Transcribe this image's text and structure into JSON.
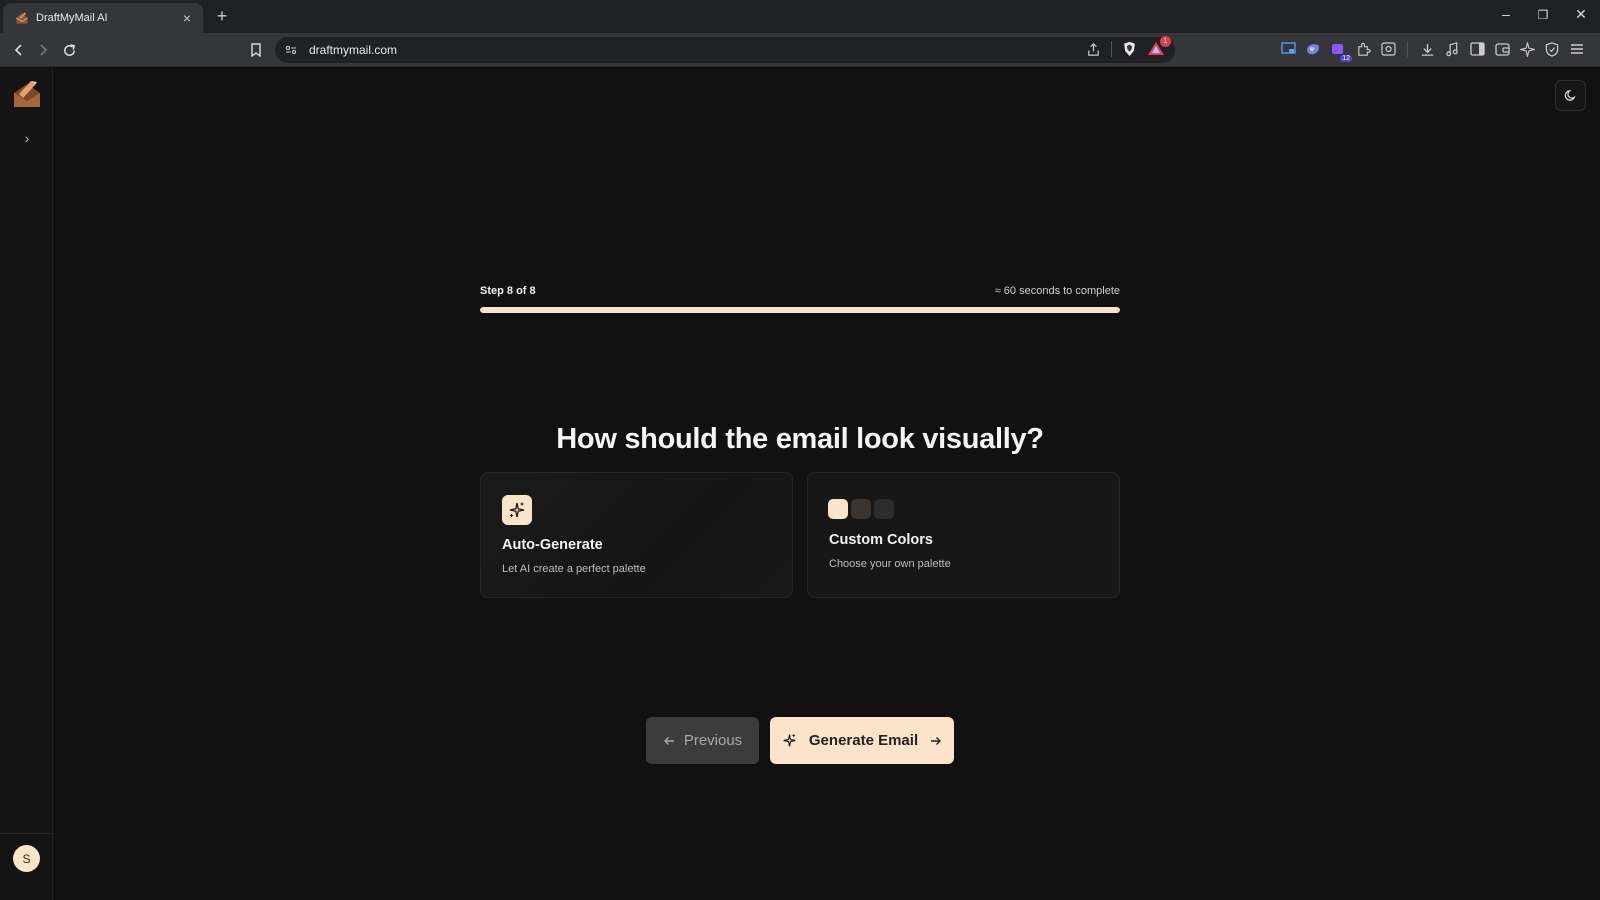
{
  "browser": {
    "tab_title": "DraftMyMail AI",
    "tab_close": "×",
    "new_tab": "+",
    "url": "draftmymail.com",
    "notification_count": "1",
    "extension_badge": "12",
    "window_controls": {
      "minimize": "–",
      "restore": "❐",
      "close": "✕"
    }
  },
  "sidebar": {
    "expand_glyph": "›",
    "avatar_initial": "S"
  },
  "progress": {
    "step_label": "Step 8 of 8",
    "time_label": "≈ 60 seconds to complete",
    "fraction": 1.0
  },
  "question": "How should the email look visually?",
  "options": [
    {
      "title": "Auto-Generate",
      "subtitle": "Let AI create a perfect palette",
      "icon": "sparkles-icon"
    },
    {
      "title": "Custom Colors",
      "subtitle": "Choose your own palette",
      "swatches": [
        "#fbe3cc",
        "#3a3530",
        "#2c2c2c"
      ]
    }
  ],
  "buttons": {
    "previous": "Previous",
    "generate": "Generate Email"
  },
  "colors": {
    "accent": "#fbe3cc",
    "background": "#111111",
    "card": "#171717"
  }
}
